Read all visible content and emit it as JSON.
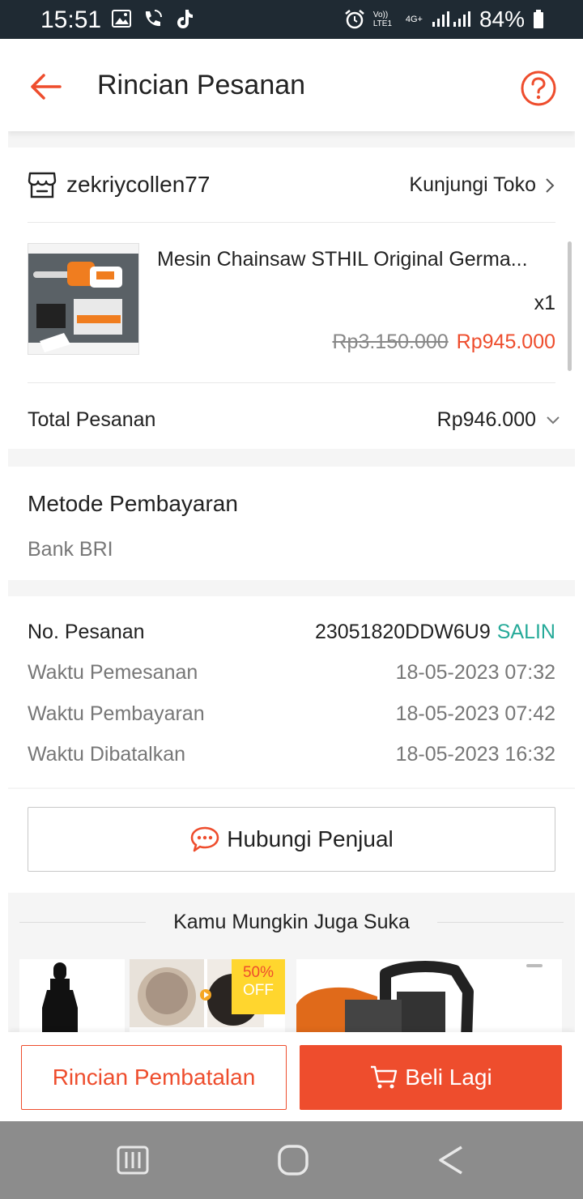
{
  "status_bar": {
    "time": "15:51",
    "network_voice": "Vo)) LTE1",
    "network_type": "4G+",
    "battery": "84%",
    "icons": [
      "image-icon",
      "call-wifi-icon",
      "tiktok-icon",
      "alarm-icon",
      "signal-icon",
      "battery-icon"
    ]
  },
  "header": {
    "title": "Rincian Pesanan",
    "back_icon": "arrow-left-icon",
    "help_icon": "question-icon"
  },
  "colors": {
    "accent": "#ee4d2d",
    "copy_link": "#26aa99",
    "muted_text": "#777777"
  },
  "shop": {
    "name": "zekriycollen77",
    "visit_label": "Kunjungi Toko"
  },
  "product": {
    "name": "Mesin Chainsaw STHIL Original Germa...",
    "quantity": "x1",
    "original_price": "Rp3.150.000",
    "price": "Rp945.000"
  },
  "order_total": {
    "label": "Total Pesanan",
    "value": "Rp946.000"
  },
  "payment": {
    "title": "Metode Pembayaran",
    "method": "Bank BRI"
  },
  "order_info": {
    "order_no_label": "No. Pesanan",
    "order_no": "23051820DDW6U9",
    "copy_label": "SALIN",
    "rows": [
      {
        "label": "Waktu Pemesanan",
        "value": "18-05-2023 07:32"
      },
      {
        "label": "Waktu Pembayaran",
        "value": "18-05-2023 07:42"
      },
      {
        "label": "Waktu Dibatalkan",
        "value": "18-05-2023 16:32"
      }
    ]
  },
  "contact": {
    "label": "Hubungi Penjual"
  },
  "recommendations": {
    "heading": "Kamu Mungkin Juga Suka",
    "badge_percent": "50%",
    "badge_off": "OFF"
  },
  "bottom_actions": {
    "cancel_details_label": "Rincian Pembatalan",
    "buy_again_label": "Beli Lagi"
  }
}
